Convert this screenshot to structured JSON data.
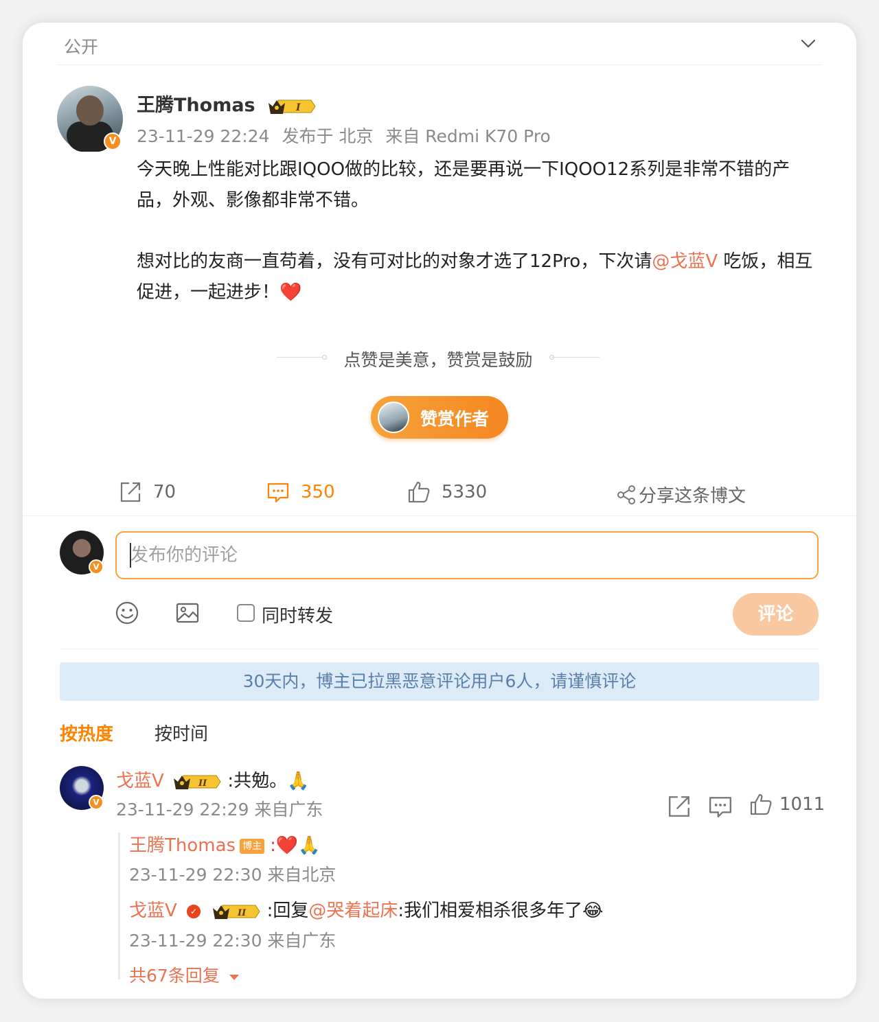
{
  "visibility": "公开",
  "post": {
    "author": "王腾Thomas",
    "date": "23-11-29 22:24",
    "published_in": "发布于 北京",
    "device": "来自 Redmi K70 Pro",
    "para1": "今天晚上性能对比跟IQOO做的比较，还是要再说一下IQOO12系列是非常不错的产品，外观、影像都非常不错。",
    "para2_pre": "想对比的友商一直苟着，没有可对比的对象才选了12Pro，下次请",
    "mention": "@戈蓝V",
    "para2_post": " 吃饭，相互促进，一起进步！",
    "heart": "❤️"
  },
  "reward": {
    "slogan": "点赞是美意，赞赏是鼓励",
    "button": "赞赏作者"
  },
  "actions": {
    "reposts": "70",
    "comments": "350",
    "likes": "5330",
    "share": "分享这条博文"
  },
  "composer": {
    "placeholder": "发布你的评论",
    "repost_label": "同时转发",
    "submit": "评论"
  },
  "notice": "30天内，博主已拉黑恶意评论用户6人，请谨慎评论",
  "sort": {
    "hot": "按热度",
    "time": "按时间"
  },
  "comment": {
    "user": "戈蓝V",
    "text": ":共勉。🙏",
    "meta": "23-11-29 22:29 来自广东",
    "likes": "1011",
    "replies": [
      {
        "user": "王腾Thomas",
        "tag": "博主",
        "text": ":❤️🙏",
        "meta": "23-11-29 22:30 来自北京"
      },
      {
        "user": "戈蓝V",
        "text_pre": ":回复",
        "mention": "@哭着起床",
        "text_post": ":我们相爱相杀很多年了😂",
        "meta": "23-11-29 22:30 来自广东"
      }
    ],
    "more": "共67条回复"
  }
}
